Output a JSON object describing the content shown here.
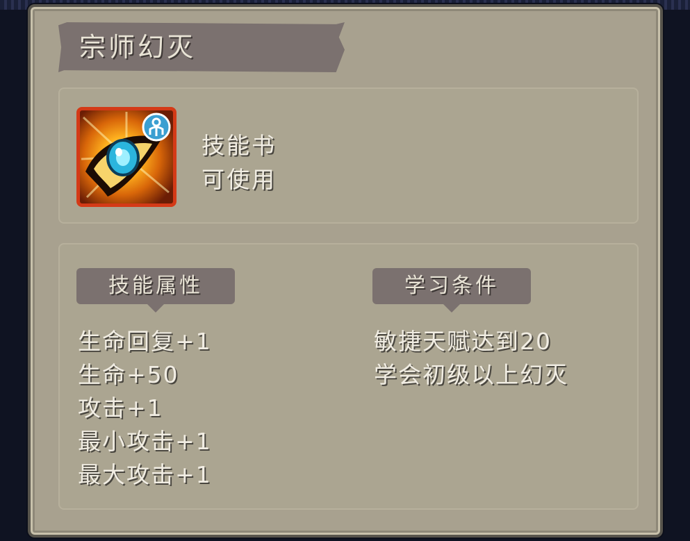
{
  "tooltip": {
    "title": "宗师幻灭",
    "item": {
      "icon": "eye-skill-icon",
      "badge_icon": "skill-book-badge-icon",
      "type_label": "技能书",
      "status_label": "可使用"
    },
    "attributes": {
      "header": "技能属性",
      "lines": [
        "生命回复+1",
        "生命+50",
        "攻击+1",
        "最小攻击+1",
        "最大攻击+1"
      ]
    },
    "requirements": {
      "header": "学习条件",
      "lines": [
        "敏捷天赋达到20",
        "学会初级以上幻灭"
      ]
    }
  },
  "colors": {
    "panel": "#a8a18f",
    "banner": "#7b716f",
    "text": "#f1ede3",
    "icon_border": "#d43a17"
  }
}
